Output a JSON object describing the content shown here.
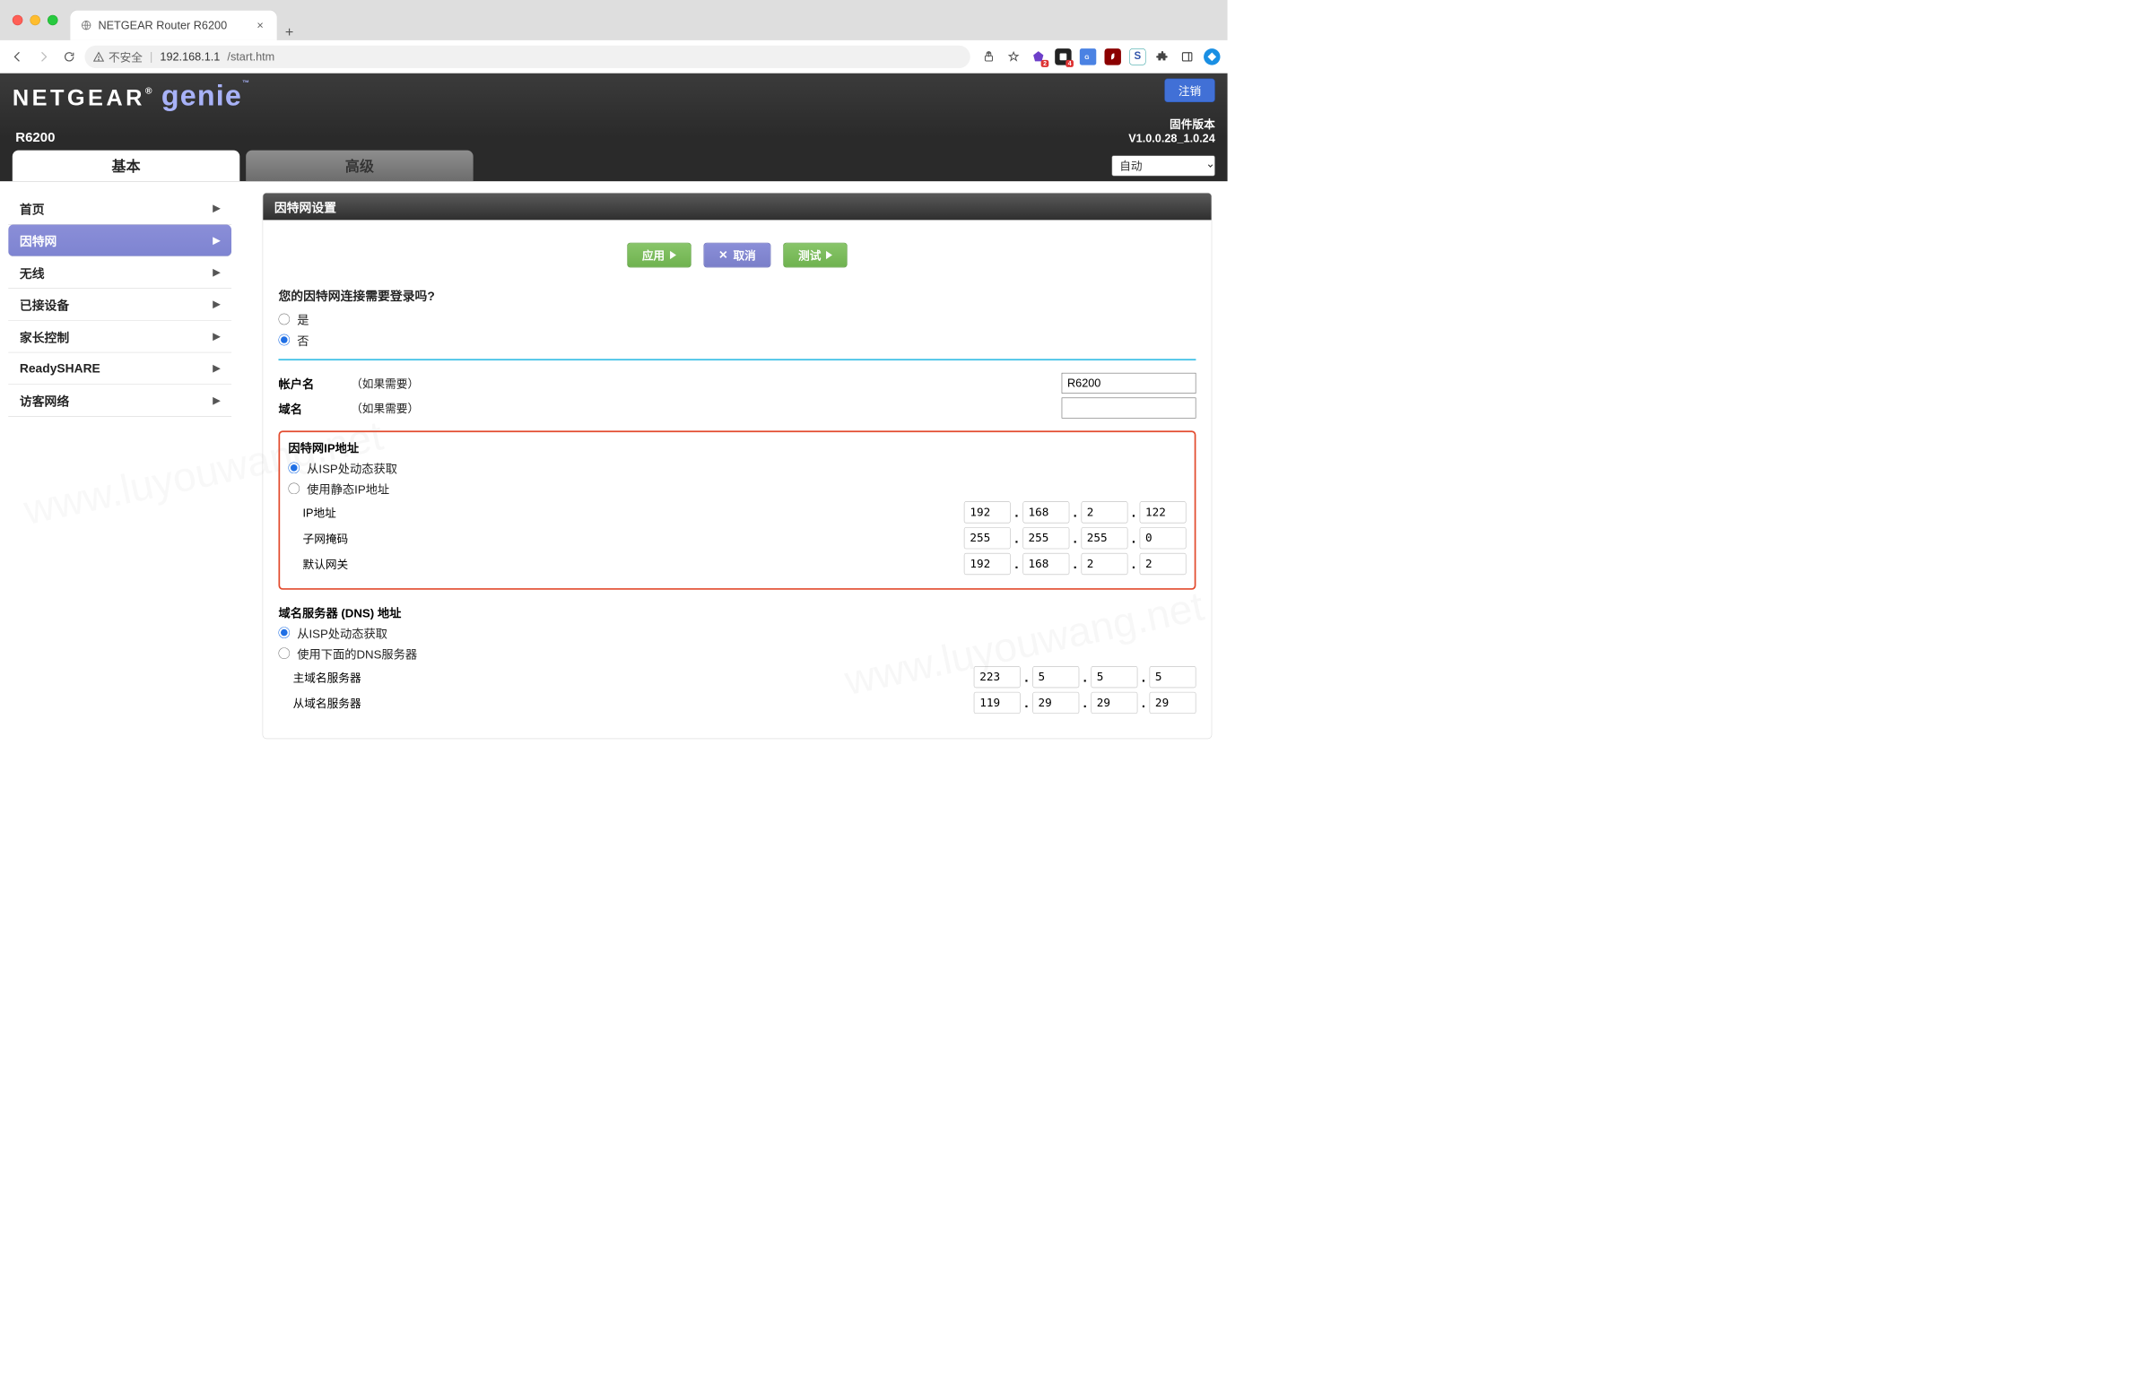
{
  "browser": {
    "tab_title": "NETGEAR Router R6200",
    "insecure_label": "不安全",
    "host": "192.168.1.1",
    "path": "/start.htm",
    "ext_badge_purple": "2",
    "ext_badge_black": "4"
  },
  "header": {
    "logo_left": "NETGEAR",
    "logo_right": "genie",
    "logout": "注销",
    "model": "R6200",
    "fw_label": "固件版本",
    "fw_version": "V1.0.0.28_1.0.24",
    "tabs": {
      "basic": "基本",
      "advanced": "高级"
    },
    "lang_selected": "自动"
  },
  "sidebar": {
    "items": [
      {
        "label": "首页",
        "active": false
      },
      {
        "label": "因特网",
        "active": true
      },
      {
        "label": "无线",
        "active": false
      },
      {
        "label": "已接设备",
        "active": false
      },
      {
        "label": "家长控制",
        "active": false
      },
      {
        "label": "ReadySHARE",
        "active": false
      },
      {
        "label": "访客网络",
        "active": false
      }
    ]
  },
  "panel": {
    "title": "因特网设置",
    "buttons": {
      "apply": "应用",
      "cancel": "取消",
      "test": "测试"
    },
    "login_q": "您的因特网连接需要登录吗?",
    "opt_yes": "是",
    "opt_no": "否",
    "account_label": "帐户名",
    "if_needed": "（如果需要）",
    "account_value": "R6200",
    "domain_label": "域名",
    "domain_value": "",
    "ip_section": "因特网IP地址",
    "ip_dynamic": "从ISP处动态获取",
    "ip_static": "使用静态IP地址",
    "ip_addr_label": "IP地址",
    "subnet_label": "子网掩码",
    "gateway_label": "默认网关",
    "ip_addr": [
      "192",
      "168",
      "2",
      "122"
    ],
    "subnet": [
      "255",
      "255",
      "255",
      "0"
    ],
    "gateway": [
      "192",
      "168",
      "2",
      "2"
    ],
    "dns_section": "域名服务器 (DNS) 地址",
    "dns_dynamic": "从ISP处动态获取",
    "dns_static": "使用下面的DNS服务器",
    "dns_primary_label": "主域名服务器",
    "dns_secondary_label": "从域名服务器",
    "dns_primary": [
      "223",
      "5",
      "5",
      "5"
    ],
    "dns_secondary": [
      "119",
      "29",
      "29",
      "29"
    ]
  }
}
